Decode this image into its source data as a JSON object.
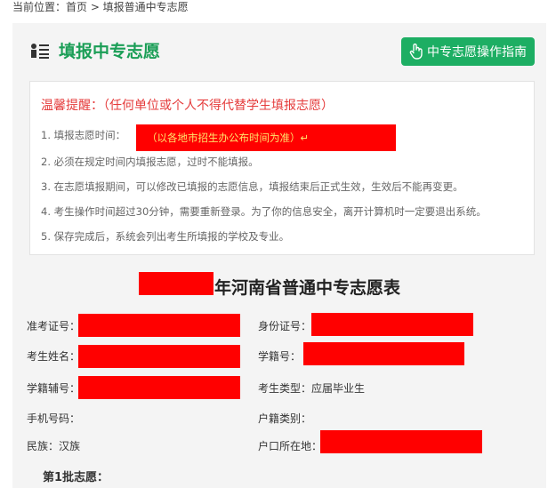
{
  "breadcrumb": "当前位置：首页 > 填报普通中专志愿",
  "header": {
    "title": "填报中专志愿",
    "guide_button": "中专志愿操作指南"
  },
  "tips": {
    "heading": "温馨提醒：（任何单位或个人不得代替学生填报志愿）",
    "items": [
      "1. 填报志愿时间：",
      "2. 必须在规定时间内填报志愿，过时不能填报。",
      "3. 在志愿填报期间，可以修改已填报的志愿信息，填报结束后正式生效，生效后不能再变更。",
      "4. 考生操作时间超过30分钟，需要重新登录。为了你的信息安全，离开计算机时一定要退出系统。",
      "5. 保存完成后，系统会列出考生所填报的学校及专业。"
    ],
    "time_highlight": "（以各地市招生办公布时间为准）↵"
  },
  "form": {
    "title": "年河南省普通中专志愿表",
    "left": [
      {
        "label": "准考证号：",
        "value": ""
      },
      {
        "label": "考生姓名：",
        "value": ""
      },
      {
        "label": "学籍辅号：",
        "value": ""
      },
      {
        "label": "手机号码：",
        "value": ""
      },
      {
        "label": "民族：汉族",
        "value": ""
      }
    ],
    "right": [
      {
        "label": "身份证号：",
        "value": ""
      },
      {
        "label": "学籍号：",
        "value": ""
      },
      {
        "label": "考生类型：应届毕业生",
        "value": ""
      },
      {
        "label": "户籍类别：",
        "value": ""
      },
      {
        "label": "户口所在地：",
        "value": ""
      }
    ],
    "batch_label": "第1批志愿："
  },
  "colors": {
    "accent_green": "#1dae63",
    "title_green": "#1a9e56",
    "warning_red": "#e53b3b",
    "redaction": "#ff0000"
  }
}
